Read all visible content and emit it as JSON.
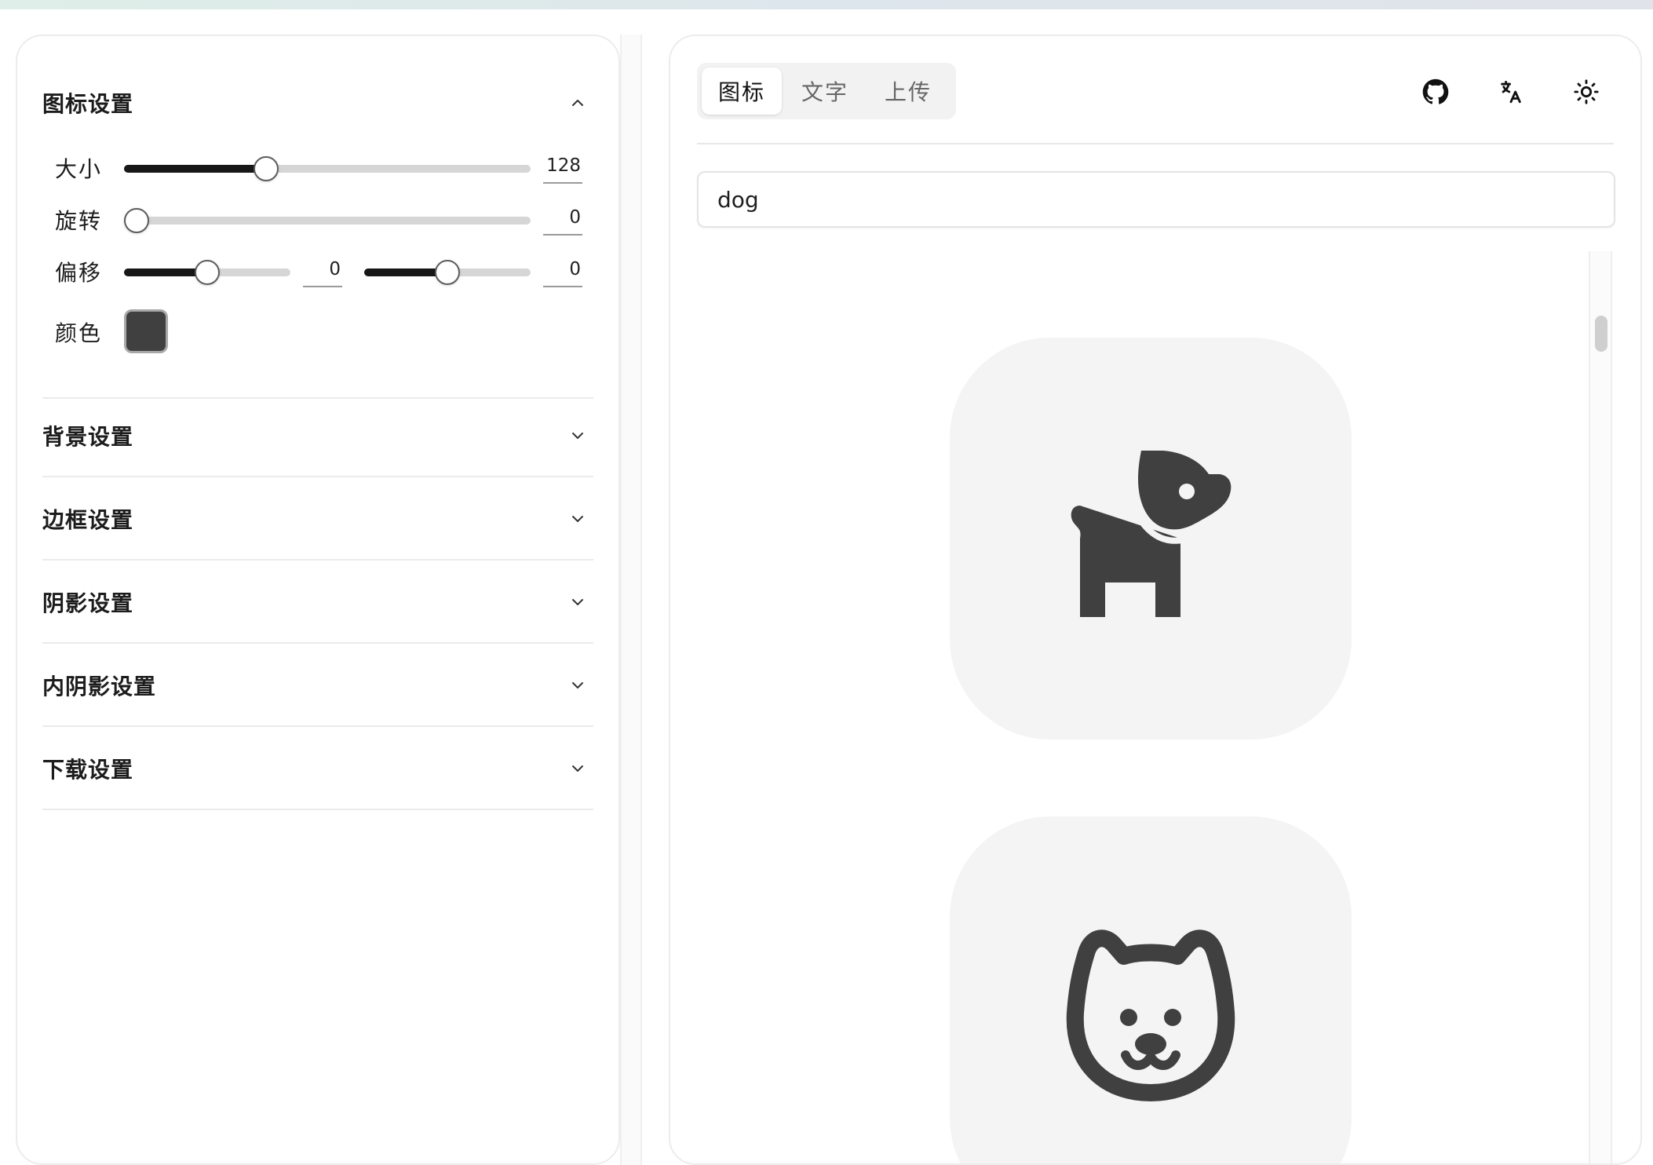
{
  "settings": {
    "icon_section": {
      "title": "图标设置",
      "size": {
        "label": "大小",
        "value": "128",
        "fraction": 0.34
      },
      "rotate": {
        "label": "旋转",
        "value": "0",
        "fraction": 0.0
      },
      "offset": {
        "label": "偏移",
        "x": {
          "value": "0",
          "fraction": 0.5
        },
        "y": {
          "value": "0",
          "fraction": 0.5
        }
      },
      "color": {
        "label": "颜色",
        "value": "#404040"
      }
    },
    "collapsed_sections": [
      {
        "title": "背景设置"
      },
      {
        "title": "边框设置"
      },
      {
        "title": "阴影设置"
      },
      {
        "title": "内阴影设置"
      },
      {
        "title": "下载设置"
      }
    ]
  },
  "main": {
    "tabs": [
      {
        "label": "图标",
        "active": true
      },
      {
        "label": "文字",
        "active": false
      },
      {
        "label": "上传",
        "active": false
      }
    ],
    "toolbar_icons": [
      "github-icon",
      "translate-icon",
      "sun-icon"
    ],
    "search": {
      "value": "dog",
      "placeholder": ""
    },
    "results": [
      {
        "icon": "dog-silhouette-icon"
      },
      {
        "icon": "dog-face-icon"
      }
    ]
  },
  "colors": {
    "icon_color": "#404040",
    "card_bg": "#f4f4f4",
    "slider_fill": "#171717"
  }
}
